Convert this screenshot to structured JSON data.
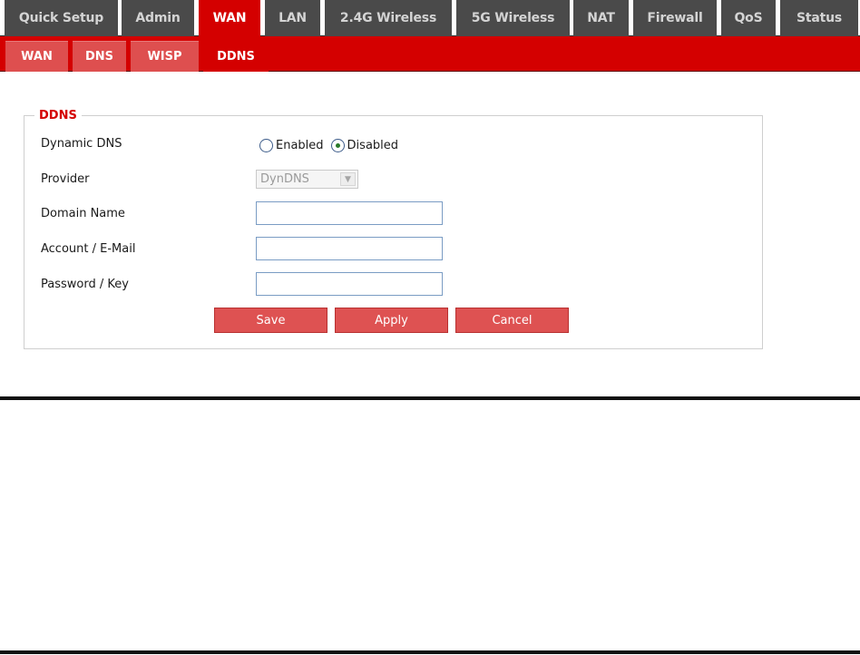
{
  "top_nav": {
    "tabs": [
      {
        "label": "Quick Setup"
      },
      {
        "label": "Admin"
      },
      {
        "label": "WAN",
        "active": true
      },
      {
        "label": "LAN"
      },
      {
        "label": "2.4G Wireless"
      },
      {
        "label": "5G Wireless"
      },
      {
        "label": "NAT"
      },
      {
        "label": "Firewall"
      },
      {
        "label": "QoS"
      },
      {
        "label": "Status"
      }
    ]
  },
  "sub_nav": {
    "tabs": [
      {
        "label": "WAN"
      },
      {
        "label": "DNS"
      },
      {
        "label": "WISP"
      },
      {
        "label": "DDNS",
        "active": true
      }
    ]
  },
  "ddns": {
    "legend": "DDNS",
    "dynamic_dns": {
      "label": "Dynamic DNS",
      "options": [
        {
          "label": "Enabled",
          "selected": false
        },
        {
          "label": "Disabled",
          "selected": true
        }
      ]
    },
    "provider": {
      "label": "Provider",
      "value": "DynDNS",
      "disabled": true
    },
    "domain_name": {
      "label": "Domain Name",
      "value": ""
    },
    "account": {
      "label": "Account / E-Mail",
      "value": ""
    },
    "password": {
      "label": "Password / Key",
      "value": ""
    },
    "buttons": {
      "save": "Save",
      "apply": "Apply",
      "cancel": "Cancel"
    }
  },
  "colors": {
    "accent_red": "#d40000",
    "tab_dark": "#4a4a4a",
    "button_red": "#de5252"
  }
}
